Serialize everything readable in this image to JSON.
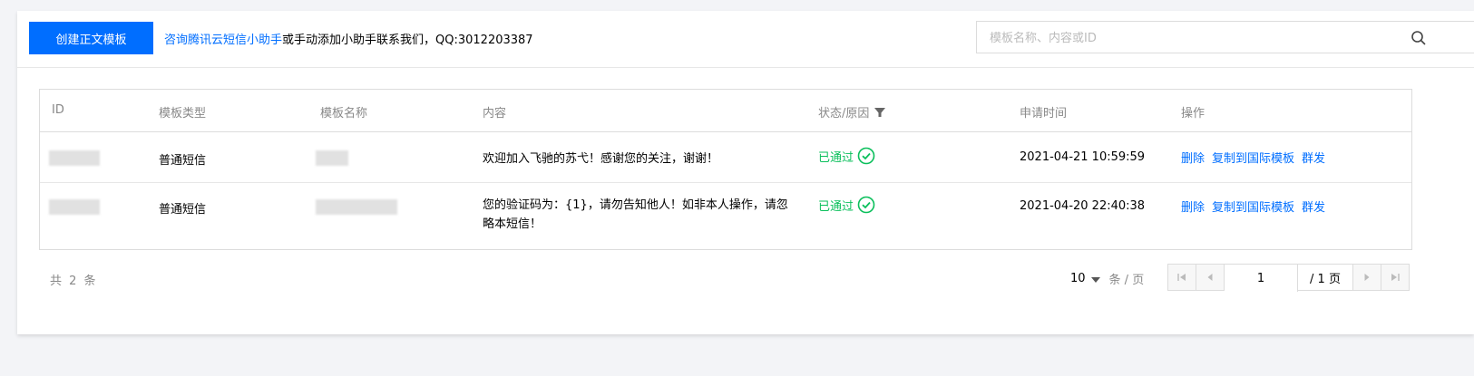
{
  "toolbar": {
    "create_button": "创建正文模板",
    "help_link": "咨询腾讯云短信小助手",
    "help_rest": "或手动添加小助手联系我们，QQ:3012203387",
    "search_placeholder": "模板名称、内容或ID"
  },
  "table": {
    "headers": [
      "ID",
      "模板类型",
      "模板名称",
      "内容",
      "状态/原因",
      "申请时间",
      "操作"
    ],
    "rows": [
      {
        "type": "普通短信",
        "content": "欢迎加入飞驰的苏弋！感谢您的关注，谢谢！",
        "status": "已通过",
        "time": "2021-04-21 10:59:59",
        "actions": [
          "删除",
          "复制到国际模板",
          "群发"
        ]
      },
      {
        "type": "普通短信",
        "content": "您的验证码为：{1}，请勿告知他人！如非本人操作，请忽略本短信！",
        "status": "已通过",
        "time": "2021-04-20 22:40:38",
        "actions": [
          "删除",
          "复制到国际模板",
          "群发"
        ]
      }
    ]
  },
  "footer": {
    "total": "共 2 条",
    "page_size": "10",
    "page_size_unit": "条 / 页",
    "current_page": "1",
    "total_pages": "/ 1 页"
  },
  "colors": {
    "primary": "#006eff",
    "success": "#0abf5b"
  }
}
